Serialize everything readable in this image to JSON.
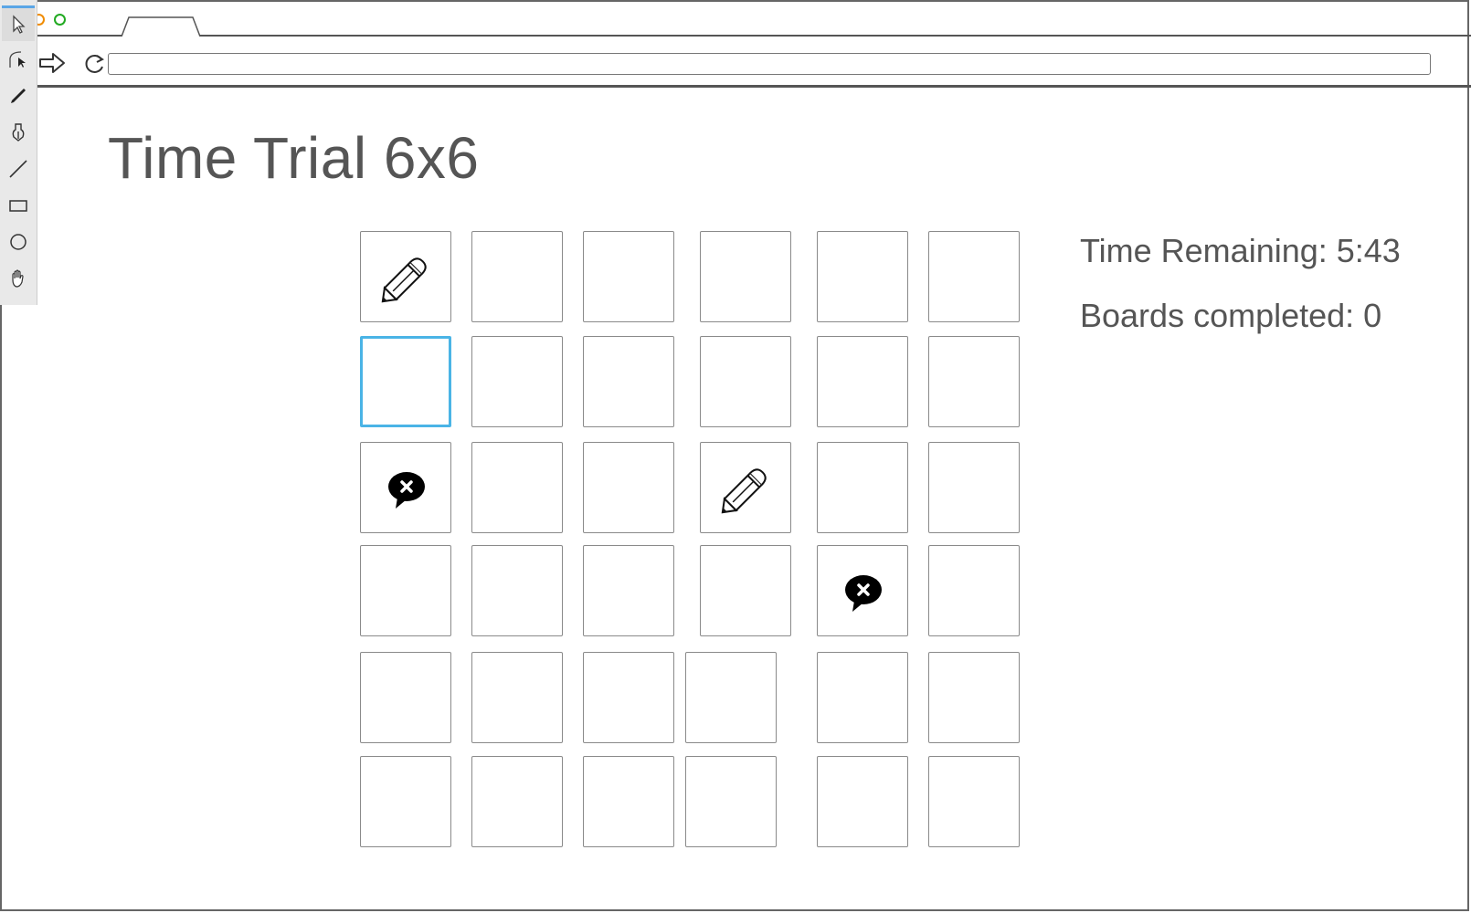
{
  "browser": {
    "url_value": "",
    "tab_label": ""
  },
  "page": {
    "title": "Time Trial 6x6"
  },
  "stats": {
    "time_remaining": "Time Remaining: 5:43",
    "boards_completed": "Boards completed: 0"
  },
  "board": {
    "rows": 6,
    "cols": 6,
    "selected_cell": [
      1,
      0
    ],
    "cells": [
      [
        "pencil-icon",
        "",
        "",
        "",
        "",
        ""
      ],
      [
        "",
        "",
        "",
        "",
        "",
        ""
      ],
      [
        "error-bubble-icon",
        "",
        "",
        "pencil-icon",
        "",
        ""
      ],
      [
        "",
        "",
        "",
        "",
        "error-bubble-icon",
        ""
      ],
      [
        "",
        "",
        "",
        "",
        "",
        ""
      ],
      [
        "",
        "",
        "",
        "",
        "",
        ""
      ]
    ]
  },
  "tools": [
    "pointer-icon",
    "bezier-icon",
    "pencil-tool-icon",
    "pen-tool-icon",
    "line-tool-icon",
    "rectangle-tool-icon",
    "ellipse-tool-icon",
    "hand-tool-icon"
  ],
  "colors": {
    "accent": "#4ab4e6",
    "minimize": "#f08c00",
    "maximize": "#22aa22",
    "text": "#555555"
  }
}
